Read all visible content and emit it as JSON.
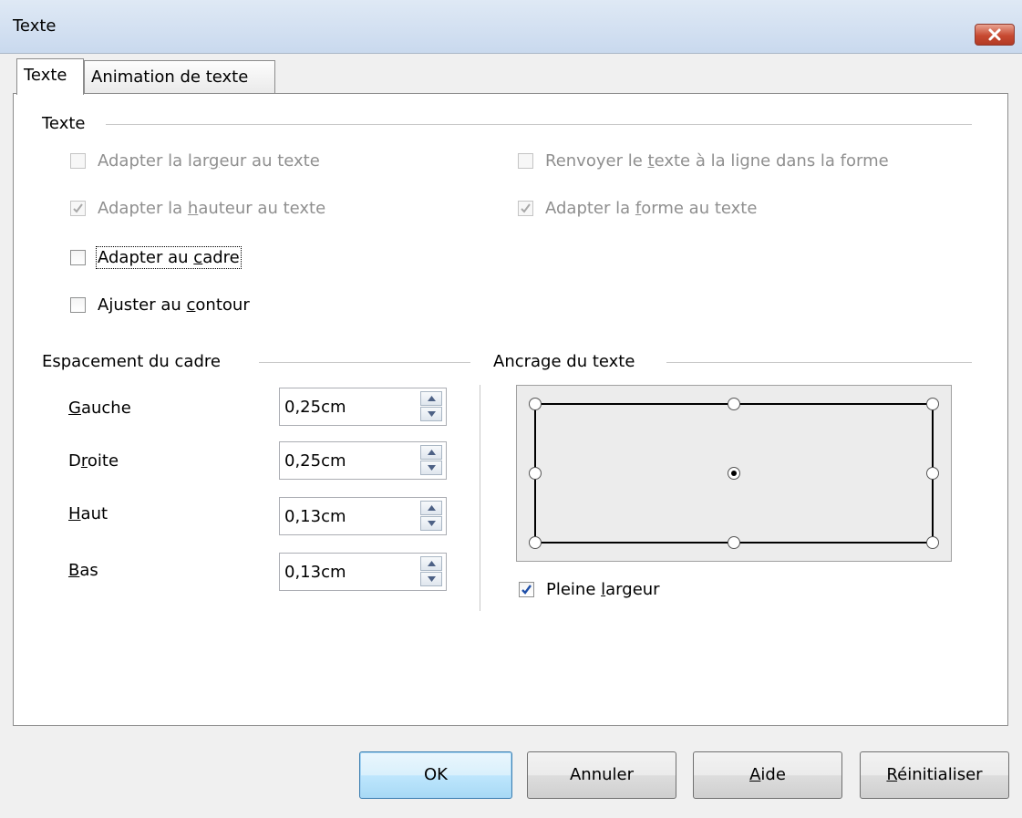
{
  "window": {
    "title": "Texte"
  },
  "tabs": [
    {
      "label": "Texte",
      "active": true
    },
    {
      "label": "Animation de texte",
      "active": false
    }
  ],
  "text_group": {
    "title": "Texte",
    "options": [
      {
        "pre": "Adapter la lar",
        "key": "g",
        "post": "eur au texte",
        "checked": false,
        "enabled": false
      },
      {
        "pre": "Renvoyer le ",
        "key": "t",
        "post": "exte à la ligne dans la forme",
        "checked": false,
        "enabled": false
      },
      {
        "pre": "Adapter la ",
        "key": "h",
        "post": "auteur au texte",
        "checked": true,
        "enabled": false
      },
      {
        "pre": "Adapter la ",
        "key": "f",
        "post": "orme au texte",
        "checked": true,
        "enabled": false
      },
      {
        "pre": "Adapter au ",
        "key": "c",
        "post": "adre",
        "checked": false,
        "enabled": true
      },
      {
        "pre": "Ajuster au ",
        "key": "c",
        "post": "ontour",
        "checked": false,
        "enabled": true
      }
    ]
  },
  "spacing_group": {
    "title": "Espacement du cadre",
    "fields": [
      {
        "pre": "",
        "key": "G",
        "post": "auche",
        "value": "0,25cm"
      },
      {
        "pre": "D",
        "key": "r",
        "post": "oite",
        "value": "0,25cm"
      },
      {
        "pre": "",
        "key": "H",
        "post": "aut",
        "value": "0,13cm"
      },
      {
        "pre": "",
        "key": "B",
        "post": "as",
        "value": "0,13cm"
      }
    ]
  },
  "anchor_group": {
    "title": "Ancrage du texte",
    "selected": "center",
    "full_width": {
      "pre": "Pleine ",
      "key": "l",
      "post": "argeur",
      "checked": true
    }
  },
  "buttons": {
    "ok": "OK",
    "cancel": "Annuler",
    "help": {
      "key": "A",
      "post": "ide"
    },
    "reset": {
      "key": "R",
      "post": "éinitialiser"
    }
  },
  "colors": {
    "title_bar": "#c9d9ee",
    "close_button": "#c74a32",
    "disabled_text": "#8f8f8f",
    "check_mark": "#1f4fa8"
  }
}
